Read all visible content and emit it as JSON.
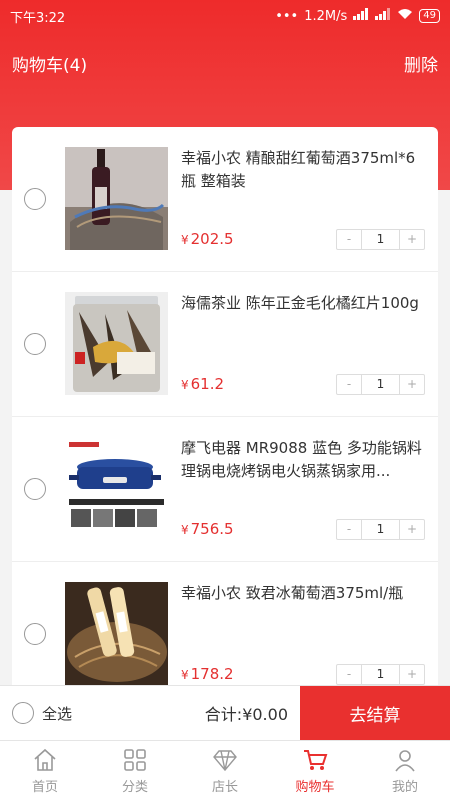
{
  "status_bar": {
    "time": "下午3:22",
    "network_speed": "1.2M/s",
    "battery": "49"
  },
  "header": {
    "title": "购物车(4)",
    "delete_label": "删除"
  },
  "cart_items": [
    {
      "title": "幸福小农 精酿甜红葡萄酒375ml*6瓶 整箱装",
      "currency": "¥",
      "price": "202.5",
      "quantity": "1",
      "image_icon": "red-wine-bottle-image"
    },
    {
      "title": "海儒茶业 陈年正金毛化橘红片100g",
      "currency": "¥",
      "price": "61.2",
      "quantity": "1",
      "image_icon": "tea-jar-image"
    },
    {
      "title": "摩飞电器 MR9088 蓝色 多功能锅料理锅电烧烤锅电火锅蒸锅家用...",
      "currency": "¥",
      "price": "756.5",
      "quantity": "1",
      "image_icon": "blue-cooker-image"
    },
    {
      "title": "幸福小农 致君冰葡萄酒375ml/瓶",
      "currency": "¥",
      "price": "178.2",
      "quantity": "1",
      "image_icon": "ice-wine-bottles-image"
    }
  ],
  "stepper": {
    "minus": "-",
    "plus": "+"
  },
  "checkout": {
    "select_all_label": "全选",
    "total_label": "合计:¥0.00",
    "checkout_button": "去结算"
  },
  "tabs": [
    {
      "label": "首页",
      "icon": "home-icon"
    },
    {
      "label": "分类",
      "icon": "category-grid-icon"
    },
    {
      "label": "店长",
      "icon": "diamond-icon"
    },
    {
      "label": "购物车",
      "icon": "cart-icon",
      "active": true
    },
    {
      "label": "我的",
      "icon": "user-icon"
    }
  ],
  "colors": {
    "brand_red": "#e9302f",
    "price_red": "#e43030",
    "tab_inactive": "#999999"
  }
}
